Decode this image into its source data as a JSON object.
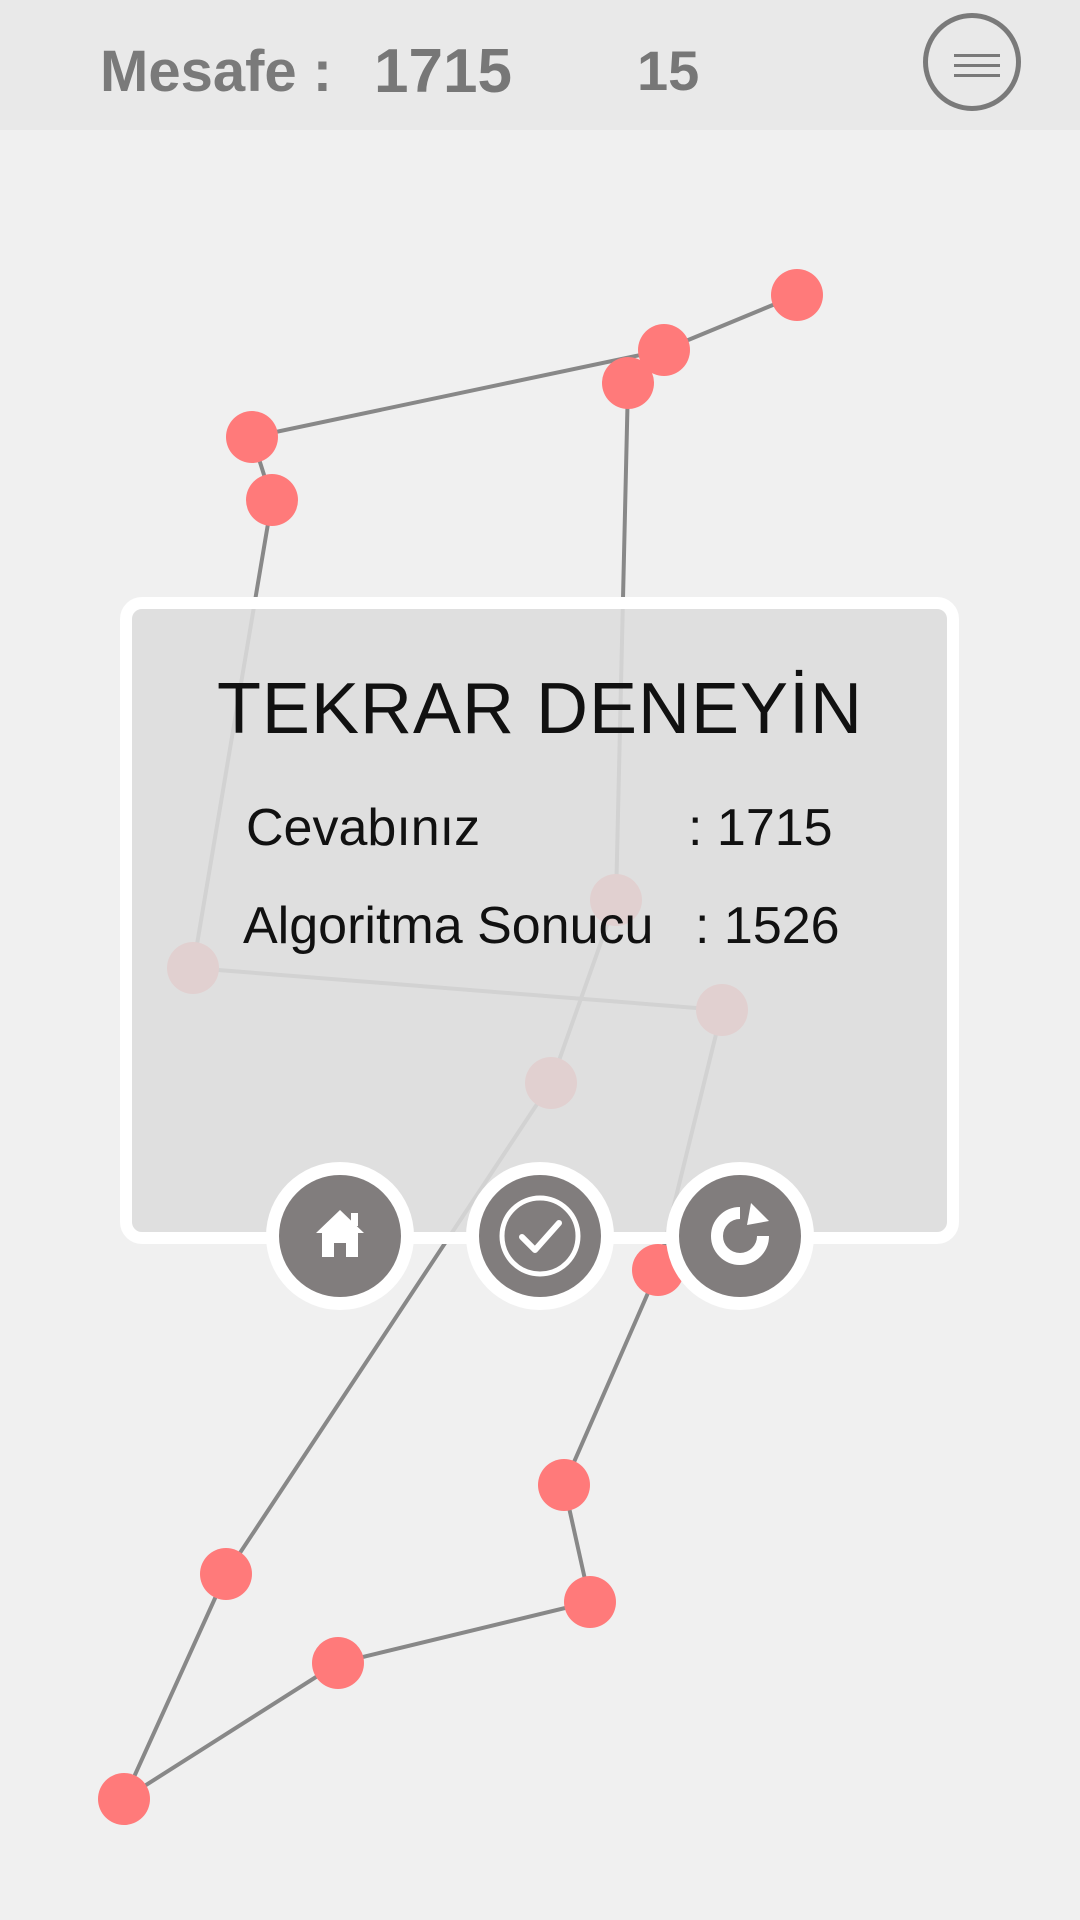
{
  "header": {
    "distance_label": "Mesafe :",
    "distance_value": "1715",
    "point_count": "15",
    "menu_icon": "hamburger-menu-icon"
  },
  "board": {
    "point_color": "#ff7a7a",
    "path_color": "#888888"
  },
  "dialog": {
    "title": "TEKRAR DENEYİN",
    "answer_label": "Cevabınız",
    "answer_value": ": 1715",
    "algorithm_label": "Algoritma Sonucu",
    "algorithm_value": ": 1526",
    "buttons": [
      {
        "name": "home-button",
        "icon": "home-icon"
      },
      {
        "name": "show-solution-button",
        "icon": "check-circle-icon"
      },
      {
        "name": "retry-button",
        "icon": "refresh-icon"
      }
    ],
    "button_color": "#817d7d"
  }
}
